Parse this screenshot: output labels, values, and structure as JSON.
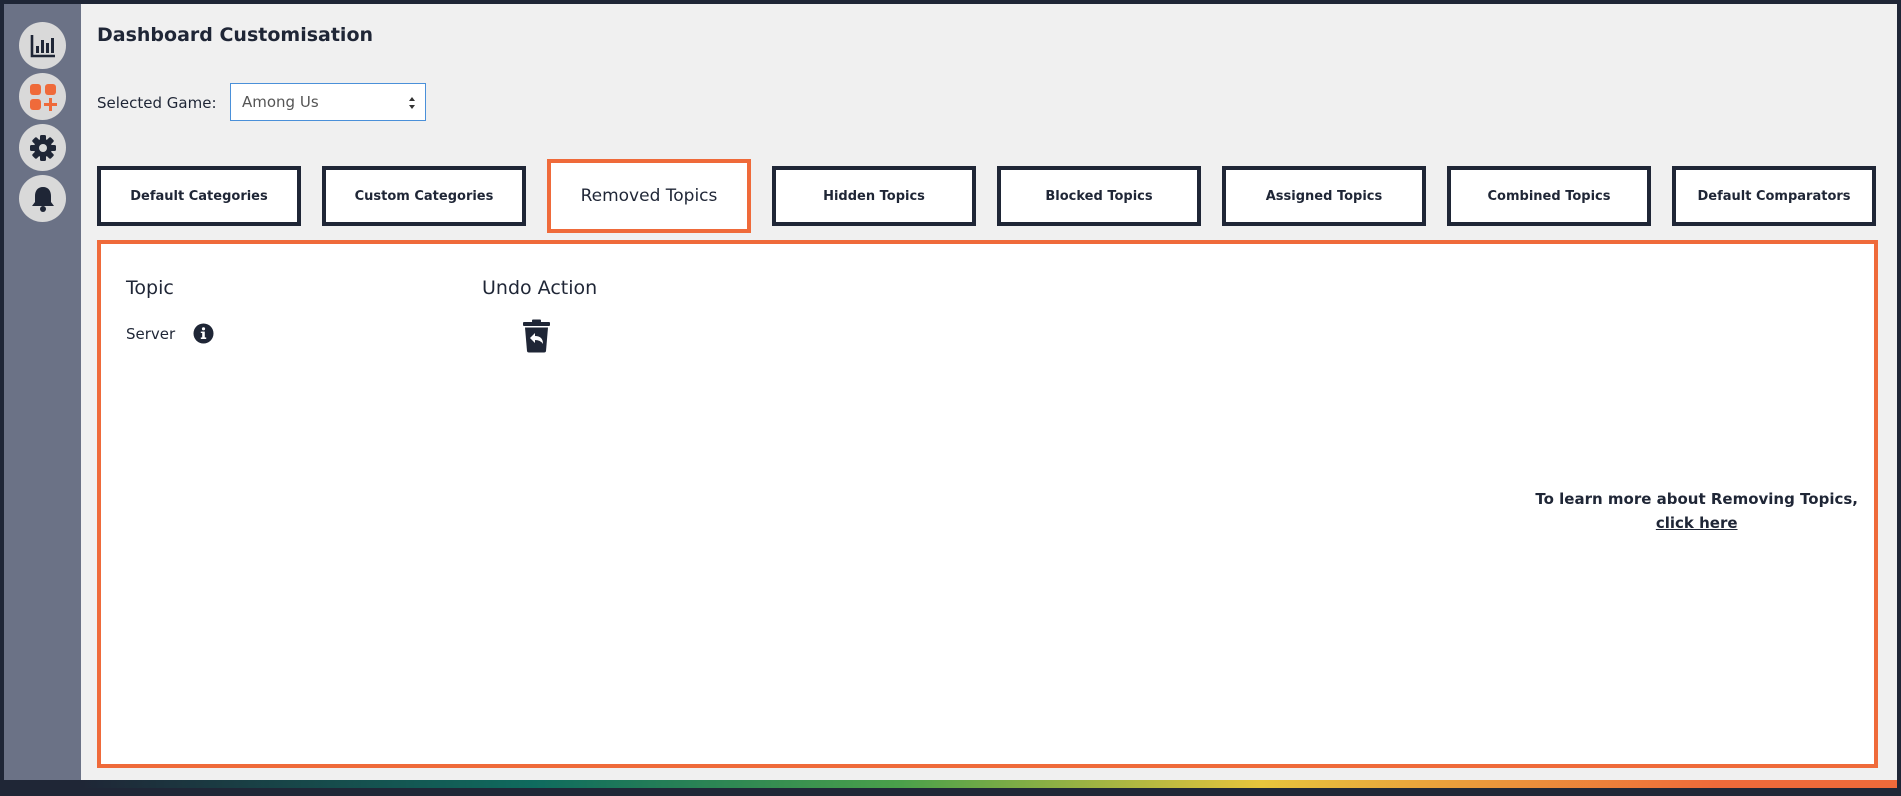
{
  "page": {
    "title": "Dashboard Customisation"
  },
  "sidebar": {
    "items": [
      {
        "icon": "bar-chart-icon"
      },
      {
        "icon": "add-widget-icon"
      },
      {
        "icon": "gear-icon"
      },
      {
        "icon": "bell-icon"
      }
    ]
  },
  "game_selector": {
    "label": "Selected Game:",
    "value": "Among Us"
  },
  "tabs": [
    {
      "label": "Default Categories",
      "active": false
    },
    {
      "label": "Custom Categories",
      "active": false
    },
    {
      "label": "Removed Topics",
      "active": true
    },
    {
      "label": "Hidden Topics",
      "active": false
    },
    {
      "label": "Blocked Topics",
      "active": false
    },
    {
      "label": "Assigned Topics",
      "active": false
    },
    {
      "label": "Combined Topics",
      "active": false
    },
    {
      "label": "Default Comparators",
      "active": false
    }
  ],
  "table": {
    "headers": {
      "topic": "Topic",
      "undo": "Undo Action"
    },
    "rows": [
      {
        "topic": "Server",
        "info_icon": "info-icon",
        "action_icon": "undo-delete-icon"
      }
    ]
  },
  "help": {
    "text": "To learn more about Removing Topics,",
    "link": "click here"
  },
  "colors": {
    "accent": "#ef6a3a",
    "navy": "#1f2636",
    "sidebar": "#6b7286",
    "background": "#f0f0f0"
  }
}
